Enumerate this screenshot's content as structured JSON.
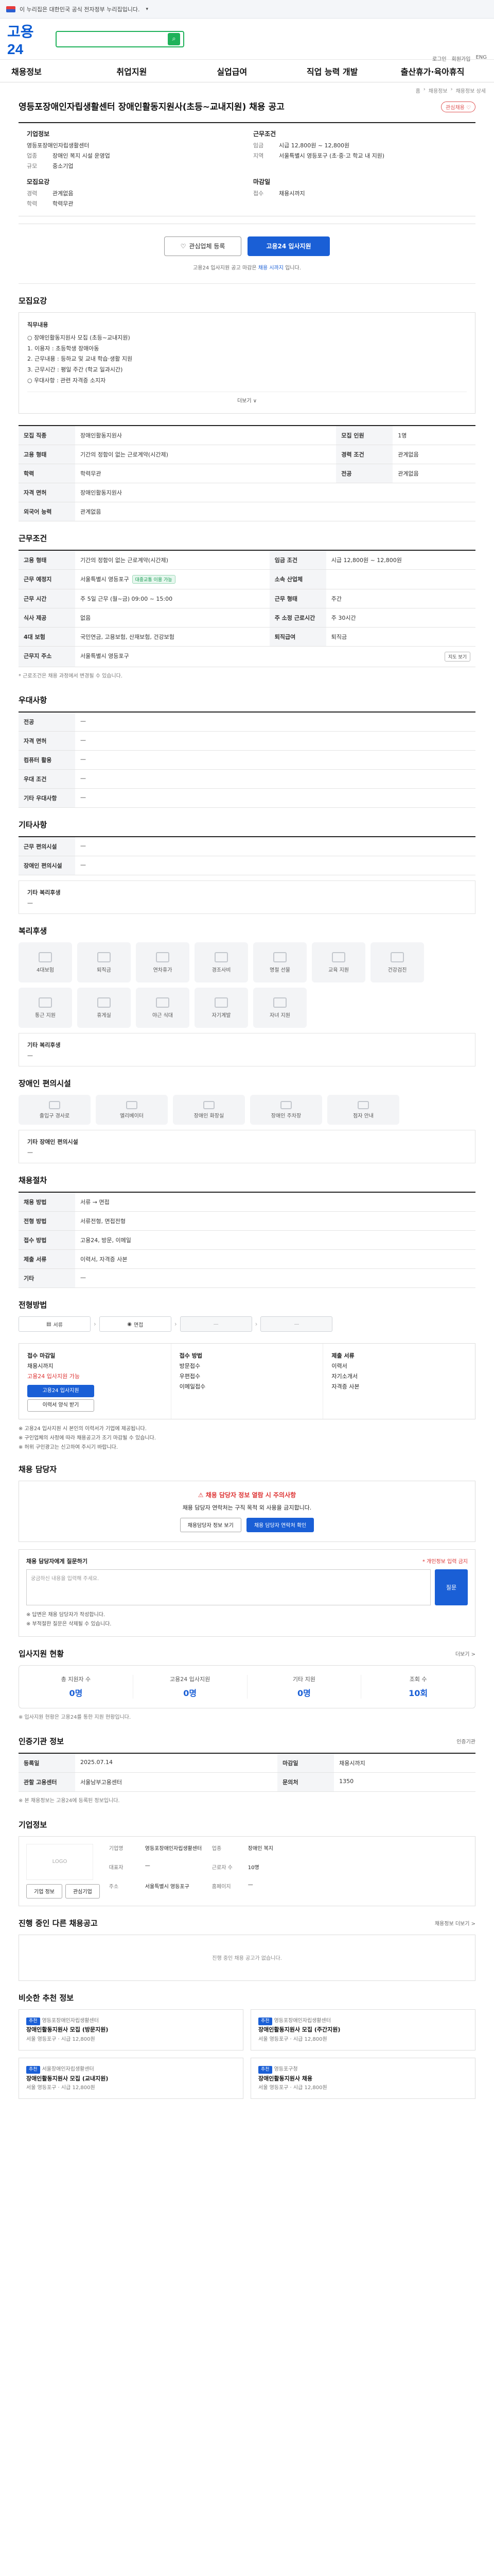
{
  "gov_banner": {
    "text": "이 누리집은 대한민국 공식 전자정부 누리집입니다."
  },
  "header": {
    "logo": "고용24",
    "util": [
      "로그인",
      "회원가입",
      "ENG"
    ]
  },
  "gnb": [
    "채용정보",
    "취업지원",
    "실업급여",
    "직업 능력 개발",
    "출산휴가·육아휴직"
  ],
  "breadcrumb": [
    "홈",
    "채용정보",
    "채용정보 상세"
  ],
  "job": {
    "title": "영등포장애인자립생활센터 장애인활동지원사(초등~교내지원) 채용 공고",
    "like": "관심채용 ♡",
    "company_label": "기업정보",
    "company_name": "영등포장애인자립생활센터",
    "company_rows": [
      {
        "k": "업종",
        "v": "장애인 복지 시설 운영업"
      },
      {
        "k": "규모",
        "v": "중소기업"
      }
    ],
    "work_label": "근무조건",
    "work_rows": [
      {
        "k": "임금",
        "v": "시급 12,800원 ~ 12,800원"
      },
      {
        "k": "지역",
        "v": "서울특별시 영등포구 (초·중·고 학교 내 지원)"
      }
    ],
    "recruit_label": "모집요강",
    "recruit_rows": [
      {
        "k": "경력",
        "v": "관계없음"
      },
      {
        "k": "학력",
        "v": "학력무관"
      }
    ],
    "deadline_label": "마감일",
    "deadline_rows": [
      {
        "k": "접수",
        "v": "채용시까지"
      }
    ]
  },
  "apply": {
    "interest_btn": "관심업체 등록",
    "apply_btn": "고용24 입사지원",
    "note_prefix": "고용24 입사지원 공고 마감은 ",
    "note_highlight": "채용 시까지",
    "note_suffix": " 입니다."
  },
  "desc": {
    "title": "모집요강",
    "subtitle": "직무내용",
    "lines": [
      "○ 장애인활동지원사 모집 (초등~교내지원)",
      "1. 이용자 : 초등학생 장애아동",
      "2. 근무내용 : 등하교 및 교내 학습·생활 지원",
      "3. 근무시간 : 평일 주간 (학교 일과시간)",
      "○ 우대사항 : 관련 자격증 소지자"
    ],
    "more": "더보기 ∨"
  },
  "recruit_table": {
    "rows": [
      {
        "k": "모집 직종",
        "v": "장애인활동지원사",
        "k2": "모집 인원",
        "v2": "1명"
      },
      {
        "k": "고용 형태",
        "v": "기간의 정함이 없는 근로계약(시간제)",
        "k2": "경력 조건",
        "v2": "관계없음"
      },
      {
        "k": "학력",
        "v": "학력무관",
        "k2": "전공",
        "v2": "관계없음"
      },
      {
        "k": "자격 면허",
        "v": "장애인활동지원사",
        "k2": "",
        "v2": ""
      },
      {
        "k": "외국어 능력",
        "v": "관계없음",
        "k2": "",
        "v2": ""
      }
    ]
  },
  "work_table": {
    "title": "근무조건",
    "rows": [
      {
        "k": "고용 형태",
        "v": "기간의 정함이 없는 근로계약(시간제)",
        "k2": "임금 조건",
        "v2": "시급 12,800원 ~ 12,800원"
      },
      {
        "k": "근무 예정지",
        "v": "서울특별시 영등포구",
        "k2": "소속 산업체",
        "v2": ""
      },
      {
        "k": "근무 시간",
        "v": "주 5일 근무 (월~금) 09:00 ~ 15:00",
        "k2": "근무 형태",
        "v2": "주간"
      },
      {
        "k": "식사 제공",
        "v": "없음",
        "k2": "주 소정 근로시간",
        "v2": "주 30시간"
      },
      {
        "k": "4대 보험",
        "v": "국민연금, 고용보험, 산재보험, 건강보험",
        "k2": "퇴직급여",
        "v2": "퇴직금"
      },
      {
        "k": "근무지 주소",
        "v": "서울특별시 영등포구",
        "k2": "",
        "v2": ""
      }
    ],
    "badge": "대중교통 이용 가능",
    "map_btn": "지도 보기",
    "note": "* 근로조건은 채용 과정에서 변경될 수 있습니다."
  },
  "pref_table": {
    "title": "우대사항",
    "rows": [
      {
        "k": "전공",
        "v": "—"
      },
      {
        "k": "자격 면허",
        "v": "—"
      },
      {
        "k": "컴퓨터 활용",
        "v": "—"
      },
      {
        "k": "우대 조건",
        "v": "—"
      },
      {
        "k": "기타 우대사항",
        "v": "—"
      }
    ]
  },
  "etc_table": {
    "title": "기타사항",
    "rows": [
      {
        "k": "근무 편의시설",
        "v": "—"
      },
      {
        "k": "장애인 편의시설",
        "v": "—"
      }
    ],
    "extra_label": "기타 복리후생",
    "extra_value": "—"
  },
  "welfare": {
    "title": "복리후생",
    "items": [
      "4대보험",
      "퇴직금",
      "연차휴가",
      "경조사비",
      "명절 선물",
      "교육 지원",
      "건강검진",
      "통근 지원",
      "휴게실",
      "야근 식대",
      "자기계발",
      "자녀 지원"
    ],
    "etc_label": "기타 복리후생",
    "etc_value": "—"
  },
  "facility": {
    "title": "장애인 편의시설",
    "items": [
      "출입구 경사로",
      "엘리베이터",
      "장애인 화장실",
      "장애인 주차장",
      "점자 안내"
    ],
    "etc_label": "기타 장애인 편의시설",
    "etc_value": "—"
  },
  "selection": {
    "title": "채용절차",
    "rows": [
      {
        "k": "채용 방법",
        "v": "서류 → 면접"
      },
      {
        "k": "전형 방법",
        "v": "서류전형, 면접전형"
      },
      {
        "k": "접수 방법",
        "v": "고용24, 방문, 이메일"
      },
      {
        "k": "제출 서류",
        "v": "이력서, 자격증 사본"
      },
      {
        "k": "기타",
        "v": "—"
      }
    ]
  },
  "process": {
    "title": "전형방법",
    "steps": [
      "서류",
      "면접",
      "—",
      "—"
    ]
  },
  "apply_method": {
    "col1_title": "접수 마감일",
    "col1_value": "채용시까지",
    "col1_red": "고용24 입사지원 가능",
    "col1_btn": "고용24 입사지원",
    "col1_btn2": "이력서 양식 받기",
    "col2_title": "접수 방법",
    "col2_lines": [
      "방문접수",
      "우편접수",
      "이메일접수"
    ],
    "col3_title": "제출 서류",
    "col3_lines": [
      "이력서",
      "자기소개서",
      "자격증 사본"
    ],
    "notices": [
      "※ 고용24 입사지원 시 본인의 이력서가 기업에 제공됩니다.",
      "※ 구인업체의 사정에 따라 채용공고가 조기 마감될 수 있습니다.",
      "※ 허위 구인광고는 신고하여 주시기 바랍니다."
    ]
  },
  "manager": {
    "title": "채용 담당자",
    "warn": "⚠ 채용 담당자 정보 열람 시 주의사항",
    "text": "채용 담당자 연락처는 구직 목적 외 사용을 금지합니다.",
    "btn1": "채용담당자 정보 보기",
    "btn2": "채용 담당자 연락처 확인"
  },
  "qna": {
    "label": "채용 담당자에게 질문하기",
    "right": "* 개인정보 입력 금지",
    "placeholder": "궁금하신 내용을 입력해 주세요.",
    "send": "질문",
    "notes": [
      "※ 답변은 채용 담당자가 작성합니다.",
      "※ 부적절한 질문은 삭제될 수 있습니다."
    ]
  },
  "stats": {
    "title": "입사지원 현황",
    "more": "더보기 >",
    "items": [
      {
        "label": "총 지원자 수",
        "value": "0명"
      },
      {
        "label": "고용24 입사지원",
        "value": "0명"
      },
      {
        "label": "기타 지원",
        "value": "0명"
      },
      {
        "label": "조회 수",
        "value": "10회"
      }
    ],
    "note": "※ 입사지원 현황은 고용24를 통한 지원 현황입니다."
  },
  "reg": {
    "title": "인증기관 정보",
    "badge": "인증기관",
    "rows": [
      {
        "k": "등록일",
        "v": "2025.07.14",
        "k2": "마감일",
        "v2": "채용시까지"
      },
      {
        "k": "관할 고용센터",
        "v": "서울남부고용센터",
        "k2": "문의처",
        "v2": "1350"
      }
    ],
    "note": "※ 본 채용정보는 고용24에 등록된 정보입니다."
  },
  "company": {
    "title": "기업정보",
    "logo_text": "LOGO",
    "btn1": "기업 정보",
    "btn2": "관심기업",
    "rows": [
      {
        "k": "기업명",
        "v": "영등포장애인자립생활센터",
        "k2": "업종",
        "v2": "장애인 복지"
      },
      {
        "k": "대표자",
        "v": "—",
        "k2": "근로자 수",
        "v2": "10명"
      },
      {
        "k": "주소",
        "v": "서울특별시 영등포구",
        "k2": "홈페이지",
        "v2": "—"
      }
    ]
  },
  "other_jobs": {
    "title": "진행 중인 다른 채용공고",
    "more": "채용정보 더보기 >",
    "empty": "진행 중인 채용 공고가 없습니다."
  },
  "related": {
    "title": "비슷한 추천 정보",
    "cards": [
      {
        "tag": "추천",
        "title": "장애인활동지원사 모집 (방문지원)",
        "meta": "서울 영등포구 · 시급 12,800원",
        "org": "영등포장애인자립생활센터"
      },
      {
        "tag": "추천",
        "title": "장애인활동지원사 모집 (주간지원)",
        "meta": "서울 영등포구 · 시급 12,800원",
        "org": "영등포장애인자립생활센터"
      },
      {
        "tag": "추천",
        "title": "장애인활동지원사 모집 (교내지원)",
        "meta": "서울 영등포구 · 시급 12,800원",
        "org": "서울장애인자립생활센터"
      },
      {
        "tag": "추천",
        "title": "장애인활동지원사 채용",
        "meta": "서울 영등포구 · 시급 12,800원",
        "org": "영등포구청"
      }
    ]
  }
}
